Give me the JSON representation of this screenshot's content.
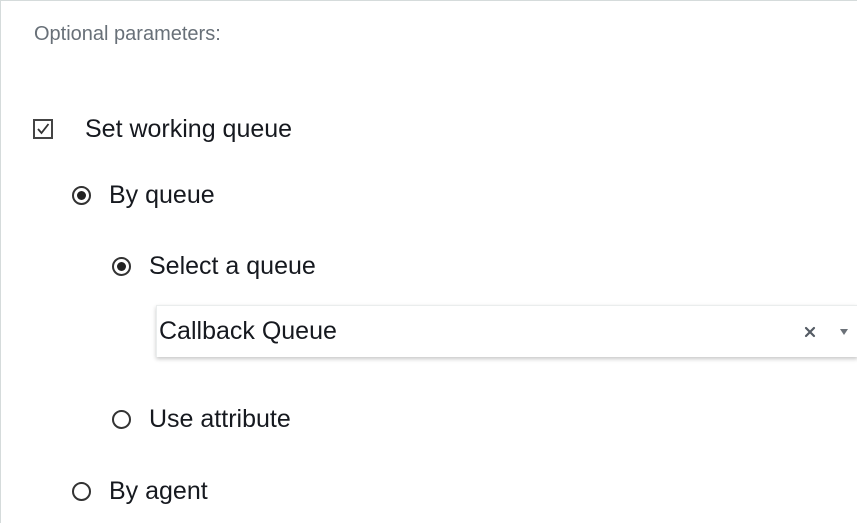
{
  "section": {
    "title": "Optional parameters:"
  },
  "working_queue": {
    "checkbox_label": "Set working queue",
    "checked": true
  },
  "by_queue": {
    "label": "By queue",
    "selected": true,
    "select_queue": {
      "label": "Select a queue",
      "selected": true,
      "dropdown": {
        "value": "Callback Queue",
        "clear_icon": "close-icon",
        "caret_icon": "caret-down-icon"
      }
    },
    "use_attribute": {
      "label": "Use attribute",
      "selected": false
    }
  },
  "by_agent": {
    "label": "By agent",
    "selected": false
  }
}
